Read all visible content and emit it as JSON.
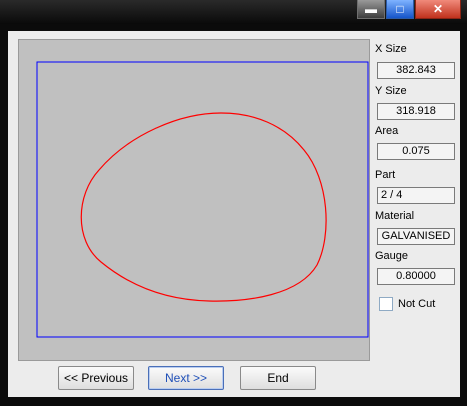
{
  "window_controls": {
    "minimize_symbol": "▬",
    "maximize_symbol": "□",
    "close_symbol": "✕"
  },
  "side": {
    "x_size_label": "X Size",
    "x_size_value": "382.843",
    "y_size_label": "Y Size",
    "y_size_value": "318.918",
    "area_label": "Area",
    "area_value": "0.075",
    "part_label": "Part",
    "part_value": "2 / 4",
    "material_label": "Material",
    "material_value": "GALVANISED",
    "gauge_label": "Gauge",
    "gauge_value": "0.80000",
    "not_cut_label": "Not Cut"
  },
  "buttons": {
    "previous": "<< Previous",
    "next": "Next >>",
    "end": "End"
  },
  "colors": {
    "boundary": "#0000ff",
    "part_outline": "#ff0000",
    "preview_bg": "#c0c0c0"
  },
  "icons": [
    "minimize-icon",
    "maximize-icon",
    "close-icon"
  ]
}
